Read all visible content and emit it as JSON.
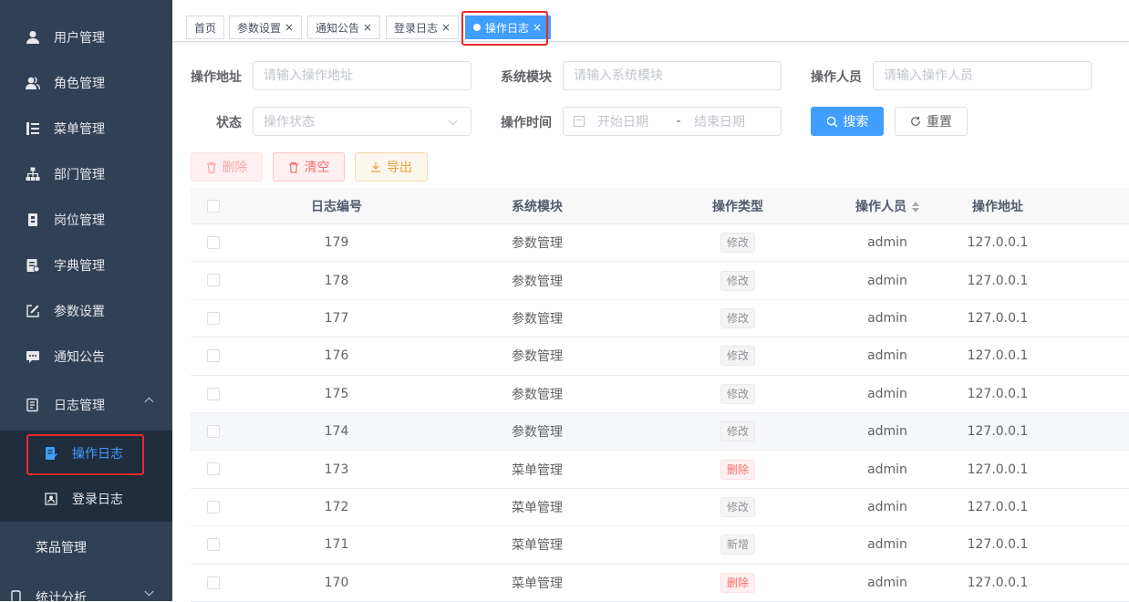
{
  "sidebar": {
    "items": [
      {
        "label": "用户管理",
        "icon": "user-icon"
      },
      {
        "label": "角色管理",
        "icon": "peoples-icon"
      },
      {
        "label": "菜单管理",
        "icon": "tree-table-icon"
      },
      {
        "label": "部门管理",
        "icon": "tree-icon"
      },
      {
        "label": "岗位管理",
        "icon": "post-icon"
      },
      {
        "label": "字典管理",
        "icon": "dict-icon"
      },
      {
        "label": "参数设置",
        "icon": "edit-icon"
      },
      {
        "label": "通知公告",
        "icon": "message-icon"
      },
      {
        "label": "日志管理",
        "icon": "log-icon"
      }
    ],
    "sub_items": [
      {
        "label": "操作日志",
        "icon": "form-icon",
        "active": true
      },
      {
        "label": "登录日志",
        "icon": "logininfor-icon",
        "active": false
      }
    ],
    "extra": [
      {
        "label": "菜品管理"
      },
      {
        "label": "统计分析"
      }
    ]
  },
  "tabs": [
    {
      "label": "首页",
      "closable": false
    },
    {
      "label": "参数设置",
      "closable": true
    },
    {
      "label": "通知公告",
      "closable": true
    },
    {
      "label": "登录日志",
      "closable": true
    },
    {
      "label": "操作日志",
      "closable": true,
      "active": true
    }
  ],
  "close_glyph": "×",
  "search": {
    "oper_ip_label": "操作地址",
    "oper_ip_placeholder": "请输入操作地址",
    "title_label": "系统模块",
    "title_placeholder": "请输入系统模块",
    "oper_name_label": "操作人员",
    "oper_name_placeholder": "请输入操作人员",
    "status_label": "状态",
    "status_placeholder": "操作状态",
    "time_label": "操作时间",
    "start_placeholder": "开始日期",
    "range_separator": "-",
    "end_placeholder": "结束日期",
    "search_button": "搜索",
    "reset_button": "重置"
  },
  "toolbar": {
    "delete_label": "删除",
    "clean_label": "清空",
    "export_label": "导出"
  },
  "table": {
    "headers": {
      "oper_id": "日志编号",
      "title": "系统模块",
      "business_type": "操作类型",
      "oper_name": "操作人员",
      "oper_ip": "操作地址"
    },
    "rows": [
      {
        "id": "179",
        "module": "参数管理",
        "type": "修改",
        "type_style": "info",
        "user": "admin",
        "ip": "127.0.0.1"
      },
      {
        "id": "178",
        "module": "参数管理",
        "type": "修改",
        "type_style": "info",
        "user": "admin",
        "ip": "127.0.0.1"
      },
      {
        "id": "177",
        "module": "参数管理",
        "type": "修改",
        "type_style": "info",
        "user": "admin",
        "ip": "127.0.0.1"
      },
      {
        "id": "176",
        "module": "参数管理",
        "type": "修改",
        "type_style": "info",
        "user": "admin",
        "ip": "127.0.0.1"
      },
      {
        "id": "175",
        "module": "参数管理",
        "type": "修改",
        "type_style": "info",
        "user": "admin",
        "ip": "127.0.0.1"
      },
      {
        "id": "174",
        "module": "参数管理",
        "type": "修改",
        "type_style": "info",
        "user": "admin",
        "ip": "127.0.0.1",
        "hover": true
      },
      {
        "id": "173",
        "module": "菜单管理",
        "type": "删除",
        "type_style": "danger",
        "user": "admin",
        "ip": "127.0.0.1"
      },
      {
        "id": "172",
        "module": "菜单管理",
        "type": "修改",
        "type_style": "info",
        "user": "admin",
        "ip": "127.0.0.1"
      },
      {
        "id": "171",
        "module": "菜单管理",
        "type": "新增",
        "type_style": "info",
        "user": "admin",
        "ip": "127.0.0.1"
      },
      {
        "id": "170",
        "module": "菜单管理",
        "type": "删除",
        "type_style": "danger",
        "user": "admin",
        "ip": "127.0.0.1"
      }
    ]
  },
  "colors": {
    "sidebar_bg": "#304156",
    "submenu_bg": "#1f2d3d",
    "primary": "#409eff",
    "danger": "#f56c6c",
    "warning": "#e6a23c",
    "highlight_box": "#e8292b"
  }
}
